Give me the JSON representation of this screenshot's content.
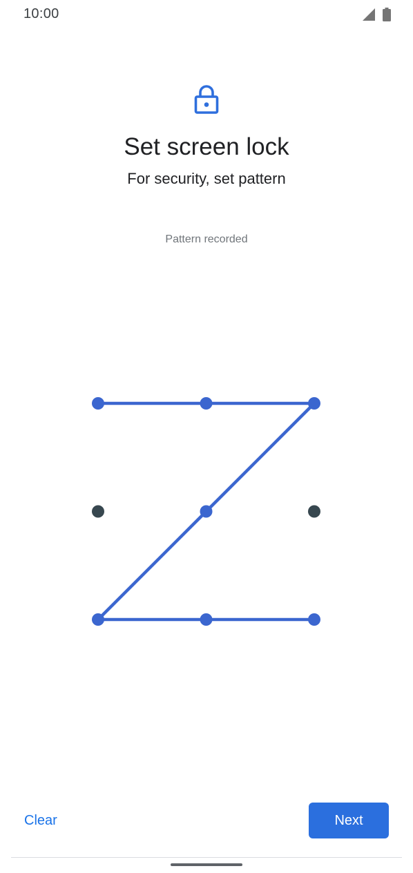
{
  "status_bar": {
    "time": "10:00",
    "icons": [
      "cellular-signal-icon",
      "battery-icon"
    ]
  },
  "header": {
    "icon": "lock-icon",
    "title": "Set screen lock",
    "subtitle": "For security, set pattern"
  },
  "pattern": {
    "message": "Pattern recorded",
    "grid_size": 3,
    "selected_sequence": [
      0,
      1,
      2,
      4,
      6,
      7,
      8
    ],
    "active_color": "#3b66cf",
    "inactive_color": "#37474f"
  },
  "buttons": {
    "clear_label": "Clear",
    "next_label": "Next"
  },
  "colors": {
    "accent": "#1a73e8",
    "primary_button": "#2b6fde"
  }
}
